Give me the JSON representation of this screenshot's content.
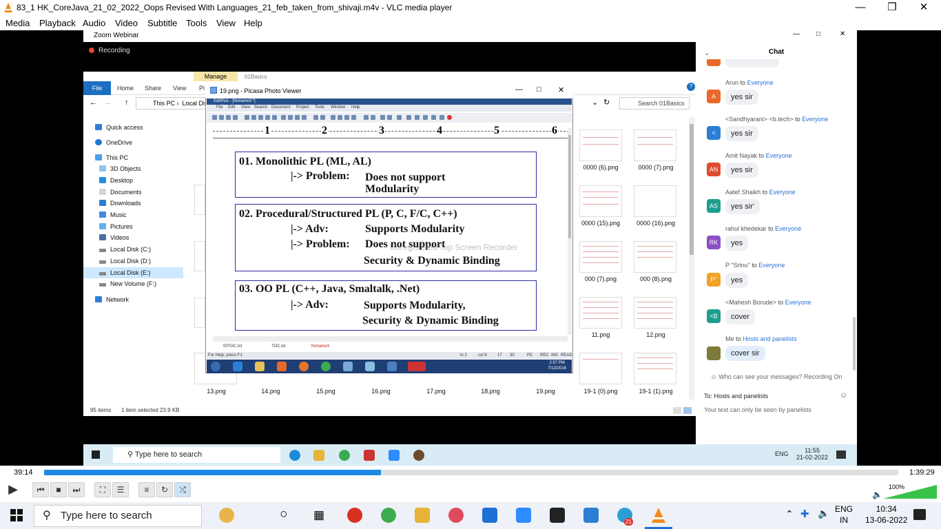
{
  "vlc": {
    "title": "83_1 HK_CoreJava_21_02_2022_Oops Revised With Languages_21_feb_taken_from_shivaji.m4v - VLC media player",
    "menu": [
      "Media",
      "Playback",
      "Audio",
      "Video",
      "Subtitle",
      "Tools",
      "View",
      "Help"
    ],
    "time_current": "39:14",
    "time_total": "1:39:29",
    "progress": 0.394,
    "volume": "100%"
  },
  "zoom": {
    "window_title": "Zoom Webinar",
    "recording": "Recording",
    "chat": {
      "title": "Chat",
      "messages": [
        {
          "sender": "Arun",
          "to": "to",
          "target": "Everyone",
          "initials": "A",
          "color": "#e8692a",
          "text": "yes sir"
        },
        {
          "sender": "<Sandhyarani> <b.tech>",
          "to": "to",
          "target": "Everyone",
          "initials": "<",
          "color": "#2a7fd4",
          "text": "yes sir"
        },
        {
          "sender": "Amit Nayak",
          "to": "to",
          "target": "Everyone",
          "initials": "AN",
          "color": "#e04a2f",
          "text": "yes sir"
        },
        {
          "sender": "Aatef Shaikh",
          "to": "to",
          "target": "Everyone",
          "initials": "AS",
          "color": "#1f9e8c",
          "text": "yes sir'"
        },
        {
          "sender": "rahul khedekar",
          "to": "to",
          "target": "Everyone",
          "initials": "RK",
          "color": "#8a4fc7",
          "text": "yes"
        },
        {
          "sender": "P \"Srinu\"",
          "to": "to",
          "target": "Everyone",
          "initials": "P\"",
          "color": "#f0a326",
          "text": "yes"
        },
        {
          "sender": "<Mahesh Borude>",
          "to": "to",
          "target": "Everyone",
          "initials": "<B",
          "color": "#1f9e8c",
          "text": "cover"
        },
        {
          "sender": "Me",
          "to": "to",
          "target": "Hosts and panelists",
          "initials": "",
          "color": "#7d7a3a",
          "text": "cover sir"
        }
      ],
      "who_can_see": "Who can see your messages? Recording On",
      "to_label": "To:",
      "to_value": "Hosts and panelists",
      "input_hint": "Your text can only be seen by panelists"
    },
    "taskbar_search": "Type here to search",
    "taskbar_lang": "ENG",
    "taskbar_time": "11:55",
    "taskbar_date": "21-02-2022"
  },
  "explorer": {
    "manage_tab": "Manage",
    "folder_tab": "01Basics",
    "ribbon": [
      "File",
      "Home",
      "Share",
      "View",
      "Pi"
    ],
    "address": [
      "This PC",
      "Local Dis"
    ],
    "search_placeholder": "Search 01Basics",
    "nav": [
      "Quick access",
      "OneDrive",
      "This PC",
      "3D Objects",
      "Desktop",
      "Documents",
      "Downloads",
      "Music",
      "Pictures",
      "Videos",
      "Local Disk (C:)",
      "Local Disk (D:)",
      "Local Disk (E:)",
      "New Volume (F:)",
      "Network"
    ],
    "thumbs_right": [
      "0000 (6).png",
      "0000 (7).png",
      "0000 (15).png",
      "0000 (16).png",
      "000 (7).png",
      "000 (8).png",
      "11.png",
      "12.png"
    ],
    "thumbs_bottom": [
      "13.png",
      "14.png",
      "15.png",
      "16.png",
      "17.png",
      "18.png",
      "19.png",
      "19-1 (0).png",
      "19-1 (1).png"
    ],
    "status_items": "95 items",
    "status_selected": "1 item selected  23.9 KB"
  },
  "picasa": {
    "title": "19.png - Picasa Photo Viewer",
    "editplus_title": "EditPlus - [Noname3 *]",
    "menu": [
      "File",
      "Edit",
      "View",
      "Search",
      "Document",
      "Project",
      "Tools",
      "Window",
      "Help"
    ],
    "ruler": [
      "1",
      "2",
      "3",
      "4",
      "5",
      "6"
    ],
    "box1": {
      "title": "01. Monolithic PL (ML, AL)",
      "l1a": "|-> Problem:",
      "l1b": "Does not support",
      "l2": "Modularity"
    },
    "box2": {
      "title": "02. Procedural/Structured PL (P, C, F/C, C++)",
      "l1a": "|-> Adv:",
      "l1b": "Supports Modularity",
      "l2a": "|-> Problem:",
      "l2b": "Does not support",
      "l3": "Security & Dynamic Binding"
    },
    "box3": {
      "title": "03. OO PL (C++, Java, Smaltalk, .Net)",
      "l1a": "|-> Adv:",
      "l1b": "Supports Modularity,",
      "l2": "Security & Dynamic Binding"
    },
    "watermark": "Unregistered Top Screen Recorder",
    "tabs": [
      "00TOC.txt",
      "TOC.txt",
      "Noname3"
    ],
    "status_help": "For Help, press F1",
    "status_cells": [
      "ln 2",
      "col 9",
      "17",
      "30",
      "PC",
      "REC",
      "INS",
      "READ"
    ],
    "inner_clock": "2:57 PM",
    "inner_date": "7/13/2016"
  },
  "win": {
    "search": "Type here to search",
    "lang1": "ENG",
    "lang2": "IN",
    "time": "10:34",
    "date": "13-06-2022",
    "badge": "21"
  }
}
